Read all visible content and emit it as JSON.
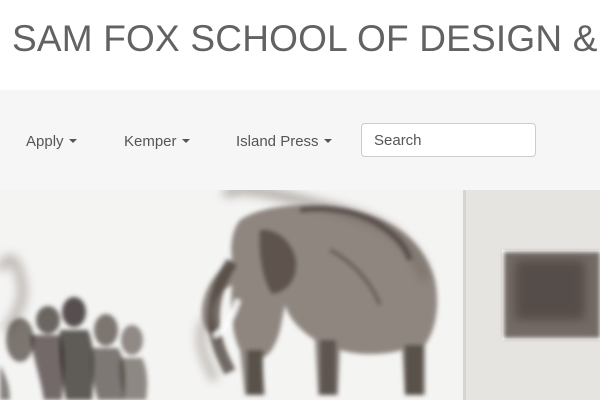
{
  "header": {
    "title": "SAM FOX SCHOOL OF DESIGN &"
  },
  "nav": {
    "items": [
      {
        "label": "Apply"
      },
      {
        "label": "Kemper"
      },
      {
        "label": "Island Press"
      }
    ],
    "search": {
      "placeholder": "Search"
    }
  },
  "hero": {
    "image_name": "smoke-drawing-elephant-exhibition"
  }
}
